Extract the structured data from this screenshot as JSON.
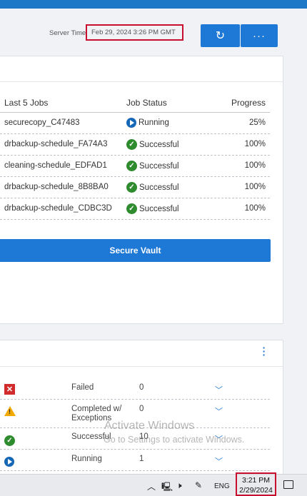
{
  "header": {
    "server_time_label": "Server Time",
    "server_time_value": "Feb 29, 2024 3:26 PM GMT",
    "refresh_icon": "refresh-icon",
    "more_icon": "ellipsis-icon",
    "refresh_glyph": "↻",
    "more_glyph": "···"
  },
  "jobs": {
    "col_job": "Last 5 Jobs",
    "col_status": "Job Status",
    "col_progress": "Progress",
    "rows": [
      {
        "name": "securecopy_C47483",
        "status": "Running",
        "progress": "25%"
      },
      {
        "name": "drbackup-schedule_FA74A3",
        "status": "Successful",
        "progress": "100%"
      },
      {
        "name": "cleaning-schedule_EDFAD1",
        "status": "Successful",
        "progress": "100%"
      },
      {
        "name": "drbackup-schedule_8B8BA0",
        "status": "Successful",
        "progress": "100%"
      },
      {
        "name": "drbackup-schedule_CDBC3D",
        "status": "Successful",
        "progress": "100%"
      }
    ]
  },
  "vault_button": "Secure Vault",
  "summary": {
    "rows": [
      {
        "label": "Failed",
        "count": "0"
      },
      {
        "label": "Completed w/\nExceptions",
        "count": "0"
      },
      {
        "label": "Successful",
        "count": "10"
      },
      {
        "label": "Running",
        "count": "1"
      }
    ]
  },
  "watermark": {
    "line1": "Activate Windows",
    "line2": "Go to Settings to activate Windows."
  },
  "taskbar": {
    "lang": "ENG",
    "time": "3:21 PM",
    "date": "2/29/2024"
  },
  "colors": {
    "accent": "#1e78d6",
    "success": "#2e8b2e",
    "running": "#1667b5",
    "failed": "#d12b2b",
    "warning": "#f2a900",
    "highlight": "#c8102e"
  }
}
